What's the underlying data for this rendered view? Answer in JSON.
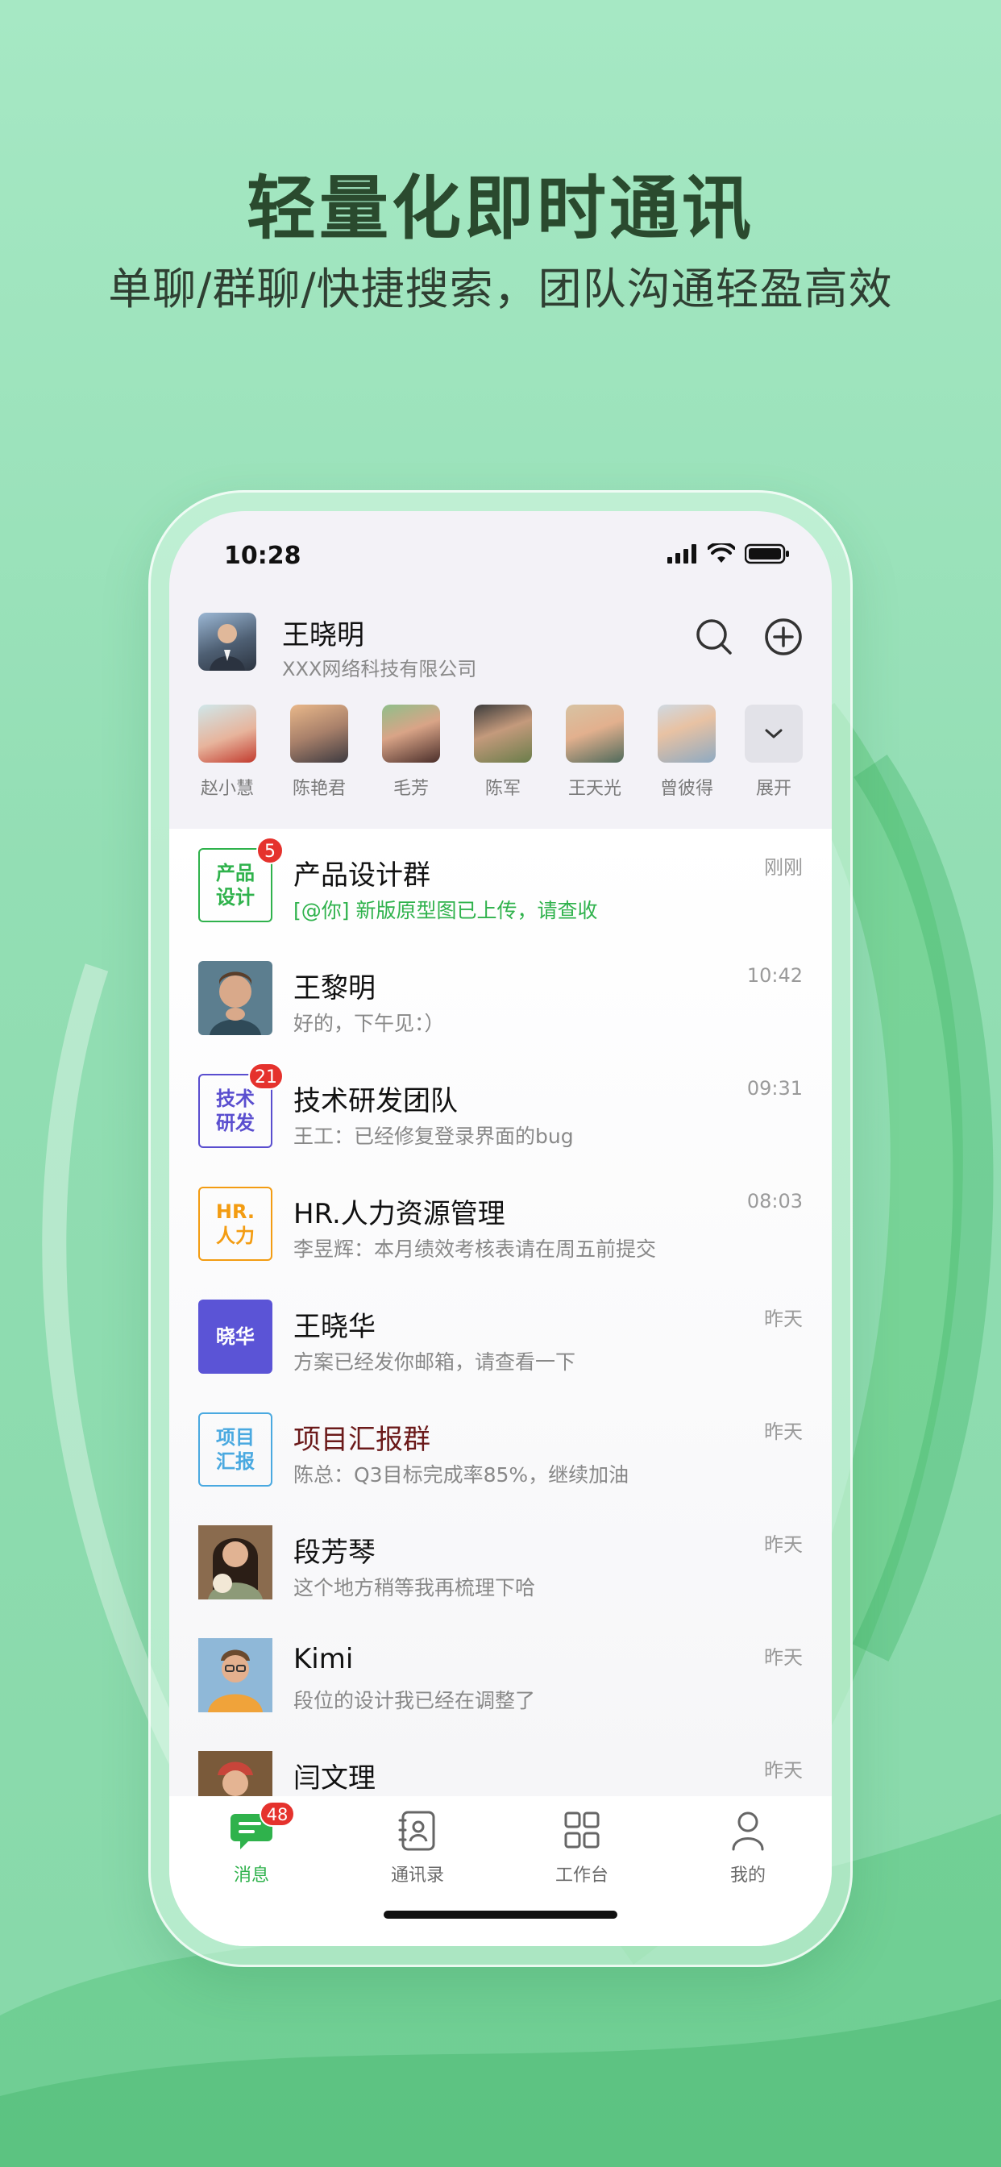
{
  "hero": {
    "title": "轻量化即时通讯",
    "subtitle": "单聊/群聊/快捷搜索，团队沟通轻盈高效"
  },
  "status_bar": {
    "time": "10:28"
  },
  "profile": {
    "name": "王晓明",
    "company": "XXX网络科技有限公司"
  },
  "contacts": [
    {
      "name": "赵小慧"
    },
    {
      "name": "陈艳君"
    },
    {
      "name": "毛芳"
    },
    {
      "name": "陈军"
    },
    {
      "name": "王天光"
    },
    {
      "name": "曾彼得"
    }
  ],
  "expand_label": "展开",
  "chats": [
    {
      "title": "产品设计群",
      "preview": "[@你] 新版原型图已上传，请查收",
      "time": "刚刚",
      "avatar_text": "产品\n设计",
      "badge": "5",
      "avatar_type": "text",
      "color": "#2fb24c"
    },
    {
      "title": "王黎明",
      "preview": "好的，下午见：）",
      "time": "10:42",
      "avatar_type": "photo"
    },
    {
      "title": "技术研发团队",
      "preview": "王工：已经修复登录界面的bug",
      "time": "09:31",
      "avatar_text": "技术\n研发",
      "badge": "21",
      "avatar_type": "text",
      "color": "#5a4ecf"
    },
    {
      "title": "HR.人力资源管理",
      "preview": "李昱辉：本月绩效考核表请在周五前提交",
      "time": "08:03",
      "avatar_text": "HR.\n人力",
      "avatar_type": "text",
      "color": "#f39c12"
    },
    {
      "title": "王晓华",
      "preview": "方案已经发你邮箱，请查看一下",
      "time": "昨天",
      "avatar_text": "晓华",
      "avatar_type": "filled",
      "color": "#5b54d6"
    },
    {
      "title": "项目汇报群",
      "preview": "陈总：Q3目标完成率85%，继续加油",
      "time": "昨天",
      "avatar_text": "项目\n汇报",
      "avatar_type": "text",
      "color": "#4aa9e0"
    },
    {
      "title": "段芳琴",
      "preview": "这个地方稍等我再梳理下哈",
      "time": "昨天",
      "avatar_type": "photo"
    },
    {
      "title": "Kimi",
      "preview": "段位的设计我已经在调整了",
      "time": "昨天",
      "avatar_type": "photo"
    },
    {
      "title": "闫文理",
      "preview": "",
      "time": "昨天",
      "avatar_type": "photo"
    }
  ],
  "tabs": [
    {
      "label": "消息",
      "badge": "48",
      "active": true
    },
    {
      "label": "通讯录"
    },
    {
      "label": "工作台"
    },
    {
      "label": "我的"
    }
  ],
  "colors": {
    "accent": "#2fb24c",
    "badge": "#e5322d",
    "group_title_highlight": "#6b1a1a"
  },
  "icons": [
    "signal-icon",
    "wifi-icon",
    "battery-icon",
    "search-icon",
    "add-icon",
    "chevron-down-icon",
    "chat-icon",
    "contacts-icon",
    "workbench-icon",
    "user-icon"
  ]
}
